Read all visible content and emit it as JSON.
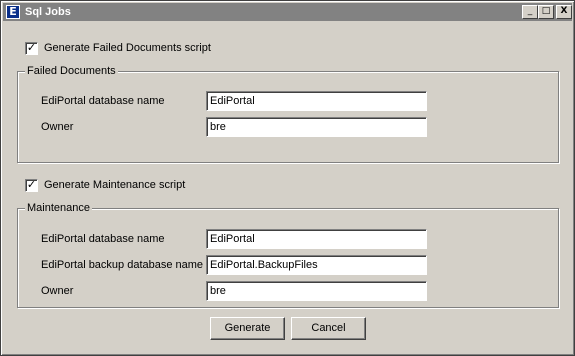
{
  "window": {
    "title": "Sql Jobs",
    "icon_letter": "E",
    "minimize": "_",
    "maximize": "□",
    "close": "X"
  },
  "failed": {
    "checkbox_label": "Generate Failed Documents script",
    "checked": true,
    "check_mark": "✓",
    "group_title": "Failed Documents",
    "db_label": "EdiPortal database name",
    "db_value": "EdiPortal",
    "owner_label": "Owner",
    "owner_value": "bre"
  },
  "maintenance": {
    "checkbox_label": "Generate Maintenance script",
    "checked": true,
    "check_mark": "✓",
    "group_title": "Maintenance",
    "db_label": "EdiPortal database name",
    "db_value": "EdiPortal",
    "backup_label": "EdiPortal backup database name",
    "backup_value": "EdiPortal.BackupFiles",
    "owner_label": "Owner",
    "owner_value": "bre"
  },
  "buttons": {
    "generate": "Generate",
    "cancel": "Cancel"
  }
}
